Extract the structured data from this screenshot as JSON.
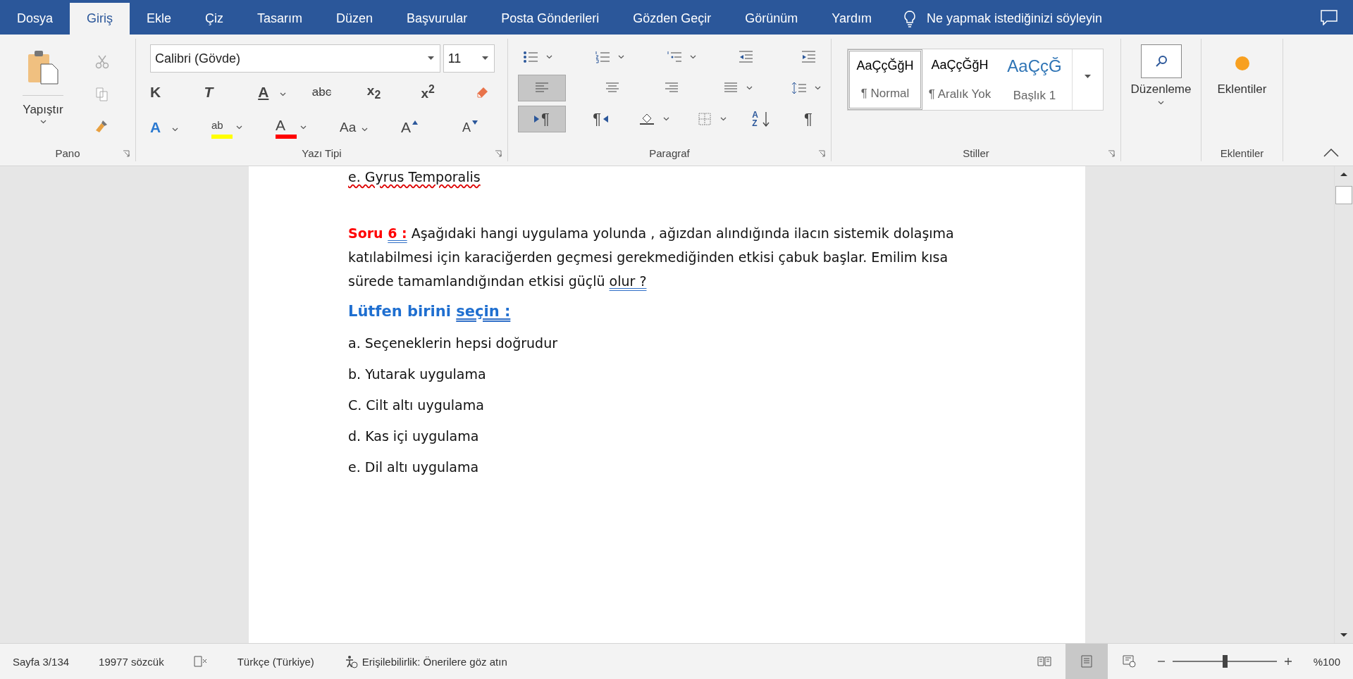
{
  "menu_tabs": [
    {
      "label": "Dosya",
      "selected": false
    },
    {
      "label": "Giriş",
      "selected": true
    },
    {
      "label": "Ekle",
      "selected": false
    },
    {
      "label": "Çiz",
      "selected": false
    },
    {
      "label": "Tasarım",
      "selected": false
    },
    {
      "label": "Düzen",
      "selected": false
    },
    {
      "label": "Başvurular",
      "selected": false
    },
    {
      "label": "Posta Gönderileri",
      "selected": false
    },
    {
      "label": "Gözden Geçir",
      "selected": false
    },
    {
      "label": "Görünüm",
      "selected": false
    },
    {
      "label": "Yardım",
      "selected": false
    }
  ],
  "tell_me": {
    "placeholder": "Ne yapmak istediğinizi söyleyin"
  },
  "ribbon": {
    "clipboard": {
      "paste_label": "Yapıştır",
      "group_label": "Pano"
    },
    "font": {
      "font_name": "Calibri (Gövde)",
      "font_size": "11",
      "group_label": "Yazı Tipi",
      "row_1": [
        {
          "kind": "bold",
          "label": "K"
        },
        {
          "kind": "italic",
          "label": "T"
        },
        {
          "kind": "underline",
          "label": "A"
        },
        {
          "kind": "strike",
          "label": "abc"
        },
        {
          "kind": "sub",
          "label": "x$_{2}$"
        },
        {
          "kind": "sup",
          "label": "x$^{2}$"
        },
        {
          "kind": "clear"
        }
      ],
      "row_2": [
        {
          "kind": "effects",
          "label": "A"
        },
        {
          "kind": "highlight",
          "label": "ab",
          "color": "#ffff00"
        },
        {
          "kind": "font_color",
          "label": "A",
          "color": "#ff0000"
        },
        {
          "kind": "case",
          "label": "Aa"
        },
        {
          "kind": "grow",
          "label": "A"
        },
        {
          "kind": "shrink",
          "label": "A"
        }
      ]
    },
    "paragraph": {
      "group_label": "Paragraf",
      "row_1": [
        {
          "kind": "bullets",
          "selected": false
        },
        {
          "kind": "numbering",
          "selected": false
        },
        {
          "kind": "multilevel",
          "selected": false
        },
        {
          "kind": "outdent",
          "selected": false
        },
        {
          "kind": "indent",
          "selected": false
        }
      ],
      "row_2": [
        {
          "kind": "align_left",
          "selected": true
        },
        {
          "kind": "align_center",
          "selected": false
        },
        {
          "kind": "align_right",
          "selected": false
        },
        {
          "kind": "justify",
          "selected": false
        },
        {
          "kind": "line_spacing",
          "selected": false
        }
      ],
      "row_3": [
        {
          "kind": "ltr",
          "label": "¶",
          "selected": true
        },
        {
          "kind": "rtl",
          "label": "¶",
          "selected": false
        },
        {
          "kind": "shading",
          "selected": false
        },
        {
          "kind": "borders",
          "selected": false
        },
        {
          "kind": "sort",
          "label": "AZ",
          "selected": false
        },
        {
          "kind": "show",
          "label": "¶",
          "selected": false
        }
      ]
    },
    "styles": {
      "group_label": "Stiller",
      "items": [
        {
          "preview": "AaÇçĞğH",
          "name": "¶ Normal",
          "selected": true
        },
        {
          "preview": "AaÇçĞğH",
          "name": "¶ Aralık Yok",
          "selected": false
        },
        {
          "preview": "AaÇçĞ",
          "name": "Başlık 1",
          "selected": false
        }
      ]
    },
    "editing": {
      "label": "Düzenleme"
    },
    "addins": {
      "label": "Eklentiler",
      "group_label": "Eklentiler"
    }
  },
  "document": {
    "previous_line": "e. Gyrus Temporalis",
    "question": {
      "label": "Soru",
      "number": "6 :",
      "text": "Aşağıdaki hangi uygulama yolunda , ağızdan alındığında ilacın sistemik dolaşıma katılabilmesi için karaciğerden geçmesi gerekmediğinden etkisi çabuk başlar. Emilim kısa sürede tamamlandığından etkisi güçlü",
      "text_end": "olur ?"
    },
    "prompt": {
      "text": "Lütfen birini",
      "text_end": "seçin :"
    },
    "options": [
      "a. Seçeneklerin hepsi doğrudur",
      "b. Yutarak uygulama",
      "C. Cilt altı uygulama",
      "d. Kas içi uygulama",
      "e. Dil altı uygulama"
    ]
  },
  "status_bar": {
    "page": "Sayfa 3/134",
    "words": "19977 sözcük",
    "language": "Türkçe (Türkiye)",
    "accessibility": "Erişilebilirlik: Önerilere göz atın",
    "views": [
      {
        "kind": "read",
        "selected": false
      },
      {
        "kind": "print",
        "selected": true
      },
      {
        "kind": "web",
        "selected": false
      }
    ],
    "zoom": {
      "level": 0.5,
      "reading": "%100"
    }
  }
}
